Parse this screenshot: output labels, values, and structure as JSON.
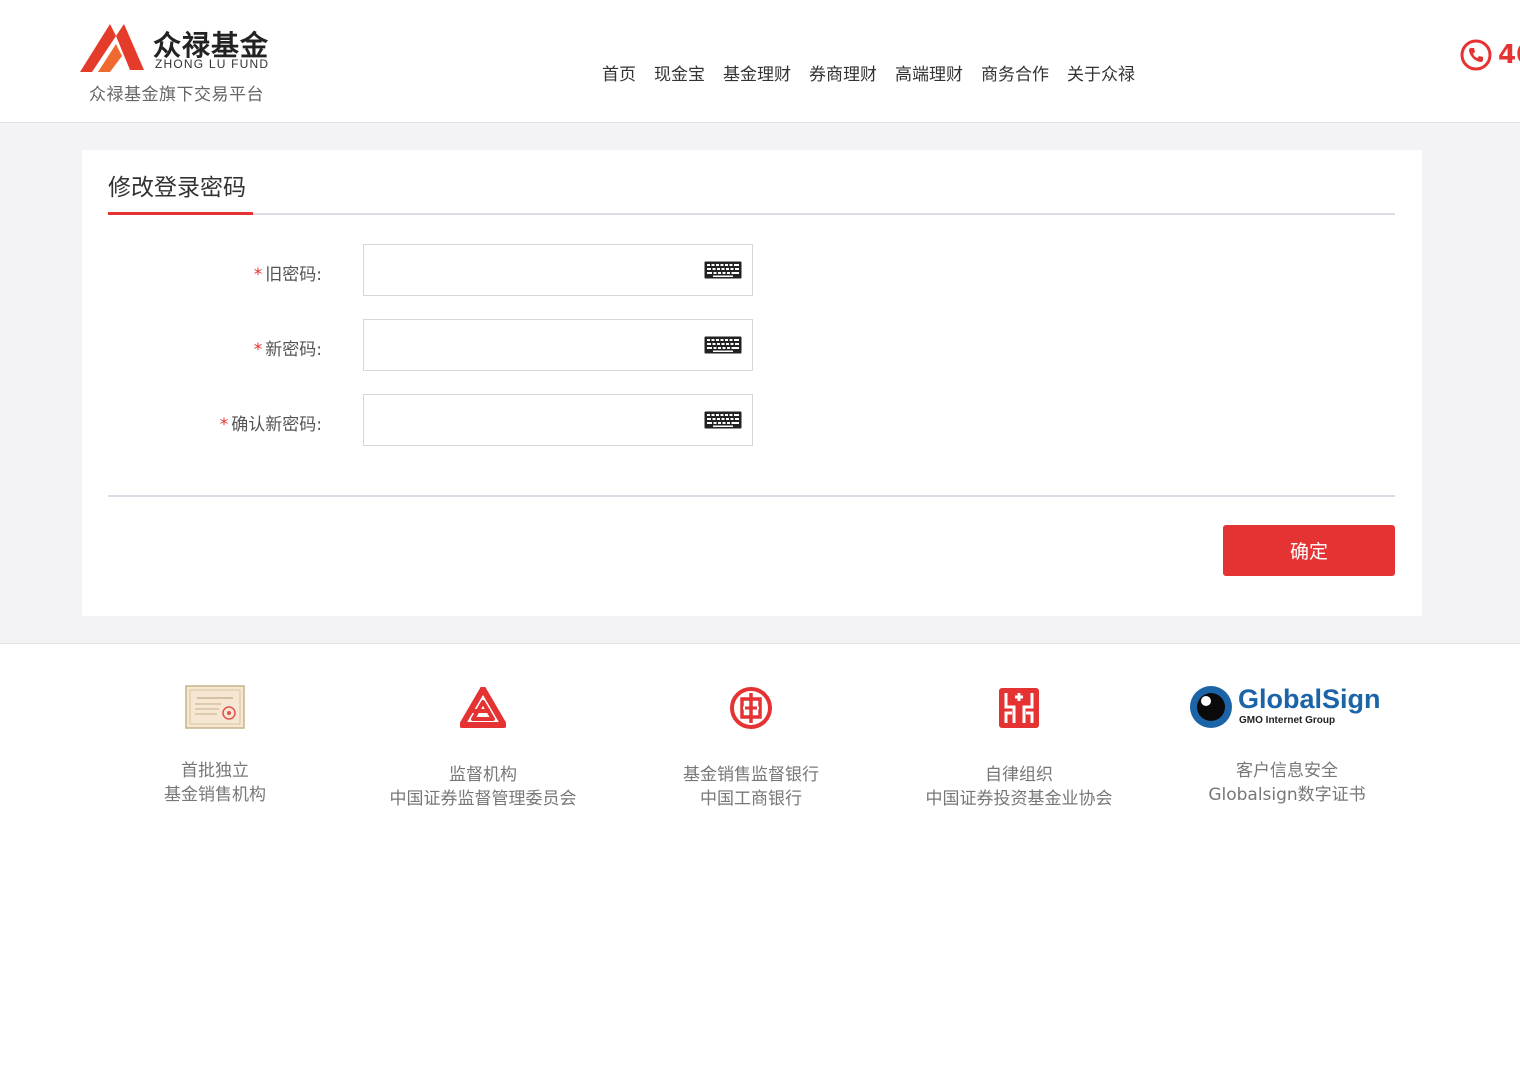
{
  "header": {
    "logo_cn": "众禄基金",
    "logo_en": "ZHONG LU FUND",
    "logo_sub": "众禄基金旗下交易平台",
    "nav": [
      "首页",
      "现金宝",
      "基金理财",
      "券商理财",
      "高端理财",
      "商务合作",
      "关于众禄"
    ],
    "phone_text": "40",
    "phone_icon": "phone-icon"
  },
  "main": {
    "title": "修改登录密码",
    "fields": [
      {
        "required": "*",
        "label": "旧密码:",
        "value": "",
        "icon": "keyboard-icon"
      },
      {
        "required": "*",
        "label": "新密码:",
        "value": "",
        "icon": "keyboard-icon"
      },
      {
        "required": "*",
        "label": "确认新密码:",
        "value": "",
        "icon": "keyboard-icon"
      }
    ],
    "confirm_label": "确定"
  },
  "footer": {
    "items": [
      {
        "icon": "certificate-icon",
        "line1": "首批独立",
        "line2": "基金销售机构"
      },
      {
        "icon": "csrc-logo-icon",
        "line1": "监督机构",
        "line2": "中国证券监督管理委员会"
      },
      {
        "icon": "icbc-logo-icon",
        "line1": "基金销售监督银行",
        "line2": "中国工商银行"
      },
      {
        "icon": "amac-logo-icon",
        "line1": "自律组织",
        "line2": "中国证券投资基金业协会"
      },
      {
        "icon": "globalsign-logo-icon",
        "logo_text": "GlobalSign",
        "logo_sub": "GMO Internet Group",
        "line1": "客户信息安全",
        "line2": "Globalsign数字证书"
      }
    ]
  },
  "colors": {
    "brand_red": "#e53232",
    "page_gray": "#f3f3f6",
    "globalsign_blue": "#1b64a8"
  }
}
